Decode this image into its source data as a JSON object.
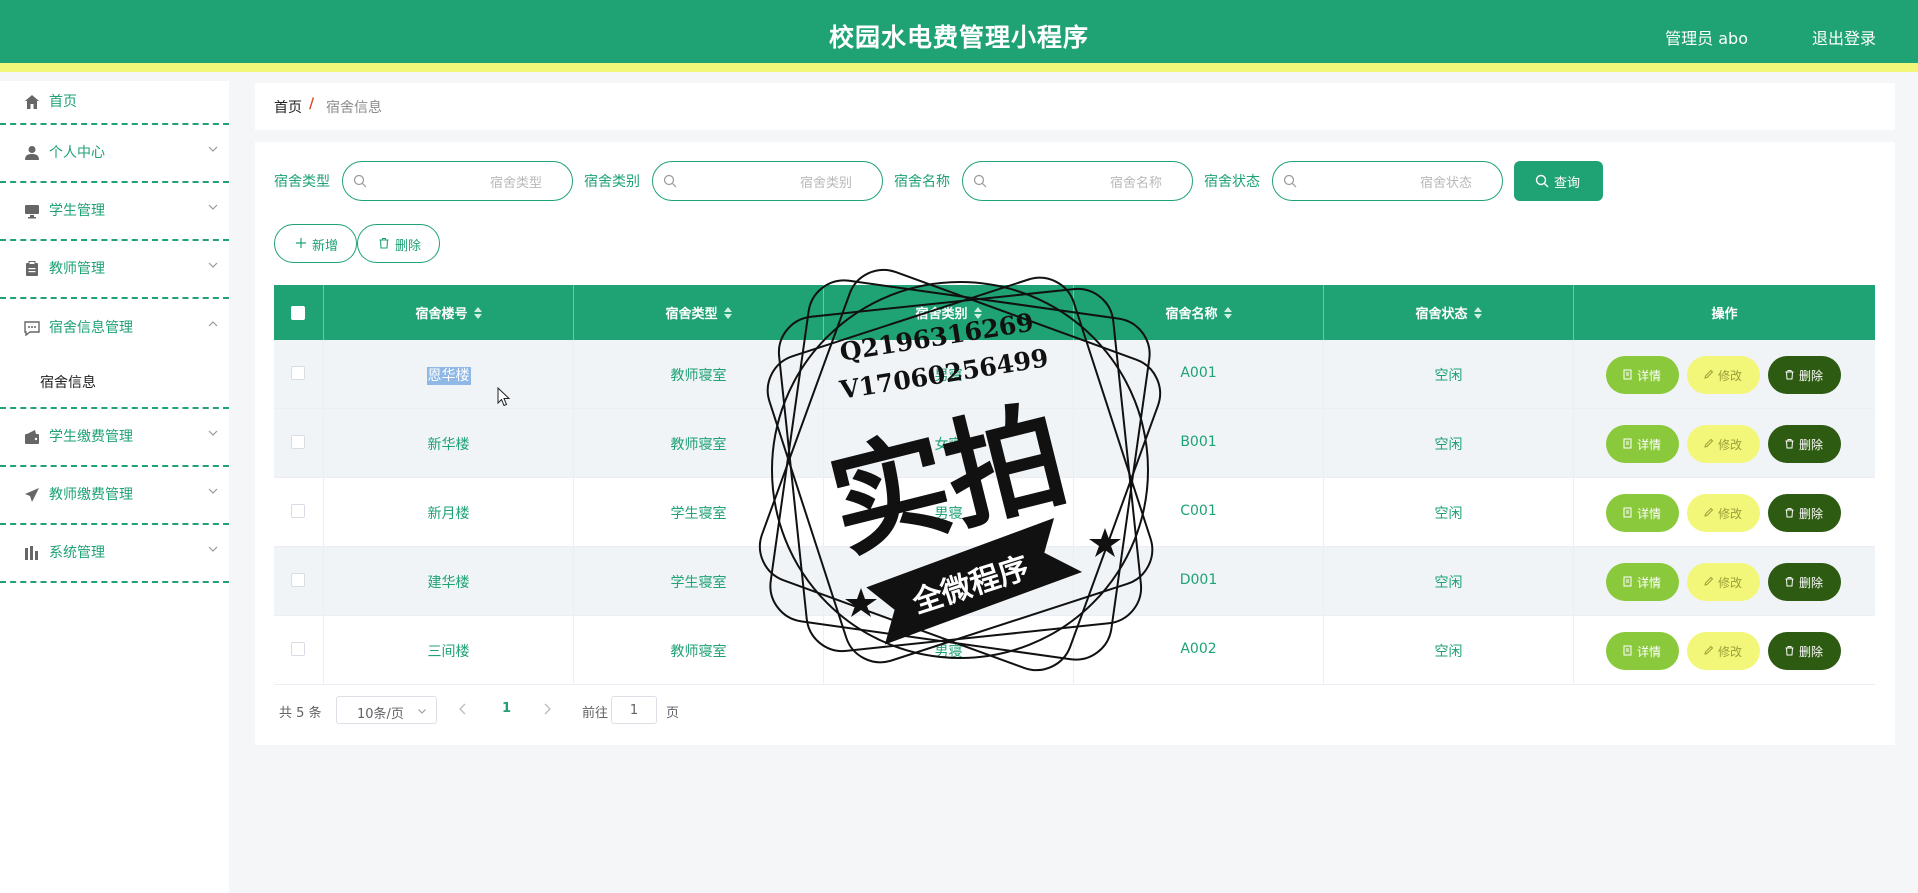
{
  "header": {
    "title": "校园水电费管理小程序",
    "admin": "管理员 abo",
    "logout": "退出登录"
  },
  "sidebar": {
    "items": [
      {
        "label": "首页",
        "icon": "home-icon"
      },
      {
        "label": "个人中心",
        "icon": "user-icon"
      },
      {
        "label": "学生管理",
        "icon": "monitor-icon"
      },
      {
        "label": "教师管理",
        "icon": "clipboard-icon"
      },
      {
        "label": "宿舍信息管理",
        "icon": "chat-icon",
        "expanded": true,
        "children": [
          {
            "label": "宿舍信息"
          }
        ]
      },
      {
        "label": "学生缴费管理",
        "icon": "wallet-icon"
      },
      {
        "label": "教师缴费管理",
        "icon": "send-icon"
      },
      {
        "label": "系统管理",
        "icon": "chart-icon"
      }
    ]
  },
  "breadcrumb": {
    "home": "首页",
    "separator": "/",
    "current": "宿舍信息"
  },
  "filters": [
    {
      "label": "宿舍类型",
      "placeholder": "宿舍类型"
    },
    {
      "label": "宿舍类别",
      "placeholder": "宿舍类别"
    },
    {
      "label": "宿舍名称",
      "placeholder": "宿舍名称"
    },
    {
      "label": "宿舍状态",
      "placeholder": "宿舍状态"
    }
  ],
  "buttons": {
    "query": "查询",
    "add": "新增",
    "delete": "删除"
  },
  "table": {
    "columns": [
      "宿舍楼号",
      "宿舍类型",
      "宿舍类别",
      "宿舍名称",
      "宿舍状态",
      "操作"
    ],
    "rows": [
      {
        "building": "恩华楼",
        "type": "教师寝室",
        "category": "男寝",
        "name": "A001",
        "status": "空闲"
      },
      {
        "building": "新华楼",
        "type": "教师寝室",
        "category": "女寝",
        "name": "B001",
        "status": "空闲"
      },
      {
        "building": "新月楼",
        "type": "学生寝室",
        "category": "男寝",
        "name": "C001",
        "status": "空闲"
      },
      {
        "building": "建华楼",
        "type": "学生寝室",
        "category": "女寝",
        "name": "D001",
        "status": "空闲"
      },
      {
        "building": "三间楼",
        "type": "教师寝室",
        "category": "男寝",
        "name": "A002",
        "status": "空闲"
      }
    ],
    "actions": {
      "detail": "详情",
      "edit": "修改",
      "delete": "删除"
    }
  },
  "pagination": {
    "total": "共 5 条",
    "page_size": "10条/页",
    "current_page": "1",
    "goto_label": "前往",
    "goto_value": "1",
    "page_unit": "页"
  },
  "watermark": {
    "line1": "Q2196316269",
    "line2": "V17060256499",
    "big_text": "实拍",
    "ribbon": "全微程序"
  },
  "colors": {
    "primary": "#1fa274",
    "accent_yellow": "#f3f779",
    "detail_green": "#8bc93c",
    "delete_dark": "#2e5b12"
  }
}
